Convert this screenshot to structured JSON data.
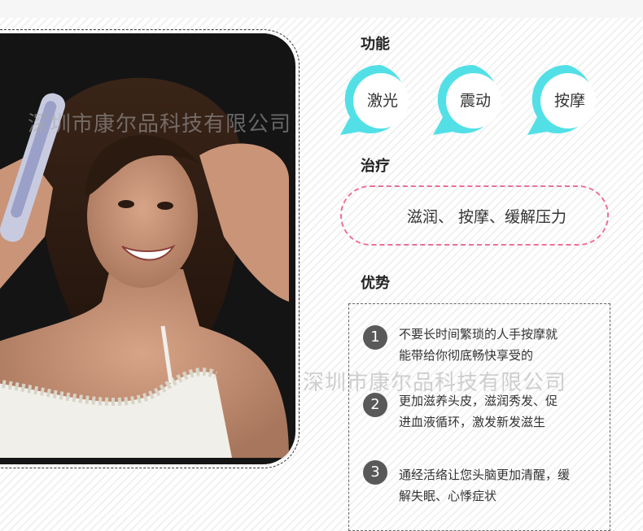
{
  "sections": {
    "function": {
      "title": "功能",
      "items": [
        "激光",
        "震动",
        "按摩"
      ],
      "bubble_color": "#52e0e6"
    },
    "treatment": {
      "title": "治疗",
      "text": "滋润、 按摩、缓解压力",
      "border_color": "#ec6f93"
    },
    "advantages": {
      "title": "优势",
      "items": [
        {
          "num": "1",
          "line1": "不要长时间繁琐的人手按摩就",
          "line2": "能带给你彻底畅快享受的"
        },
        {
          "num": "2",
          "line1": "更加滋养头皮，滋润秀发、促",
          "line2": "进血液循环，激发新发滋生"
        },
        {
          "num": "3",
          "line1": "通经活络让您头脑更加清醒，缓",
          "line2": "解失眠、心悸症状"
        }
      ]
    }
  },
  "watermark": "深圳市康尔品科技有限公司",
  "photo": {
    "subject": "woman-using-laser-comb",
    "background": "#151515"
  }
}
